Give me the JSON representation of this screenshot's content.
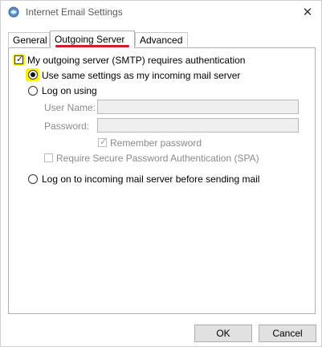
{
  "window": {
    "title": "Internet Email Settings",
    "close_glyph": "✕"
  },
  "tabs": [
    {
      "label": "General"
    },
    {
      "label": "Outgoing Server",
      "active": true
    },
    {
      "label": "Advanced"
    }
  ],
  "smtp_auth": {
    "label": "My outgoing server (SMTP) requires authentication",
    "checked": true
  },
  "options": {
    "use_same": {
      "label": "Use same settings as my incoming mail server",
      "selected": true
    },
    "log_on_using": {
      "label": "Log on using",
      "selected": false
    },
    "log_on_incoming": {
      "label": "Log on to incoming mail server before sending mail",
      "selected": false
    }
  },
  "credentials": {
    "user_name_label": "User Name:",
    "user_name_value": "",
    "password_label": "Password:",
    "password_value": "",
    "remember_password": {
      "label": "Remember password",
      "checked": true,
      "disabled": true
    },
    "spa": {
      "label": "Require Secure Password Authentication (SPA)",
      "checked": false,
      "disabled": true
    }
  },
  "buttons": {
    "ok": "OK",
    "cancel": "Cancel"
  },
  "colors": {
    "highlight": "#fff200",
    "underline": "#d11a2a"
  }
}
